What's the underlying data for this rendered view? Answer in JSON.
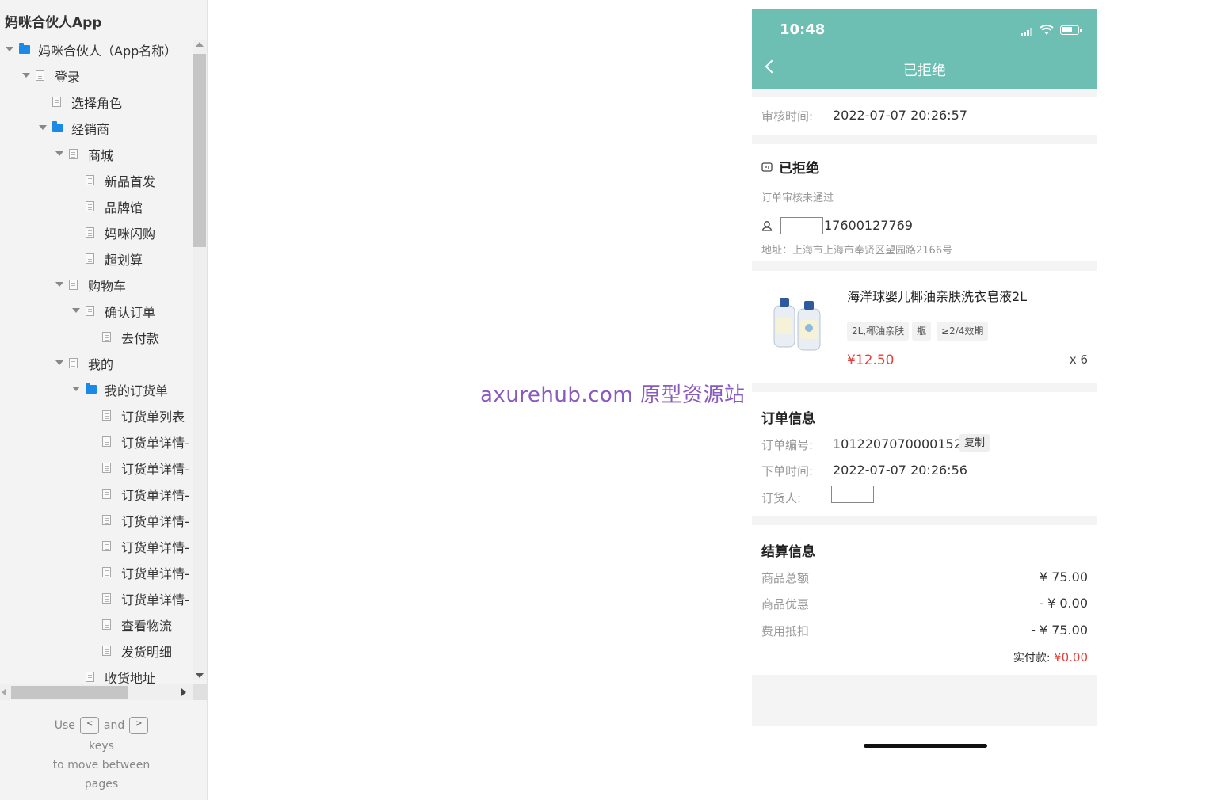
{
  "sitemap": {
    "app_title": "妈咪合伙人App",
    "items": [
      {
        "label": "妈咪合伙人（App名称）",
        "level": 0,
        "icon": "folder-icon",
        "expanded": true
      },
      {
        "label": "登录",
        "level": 1,
        "icon": "page-icon",
        "expanded": true
      },
      {
        "label": "选择角色",
        "level": 2,
        "icon": "page-icon",
        "expanded": null
      },
      {
        "label": "经销商",
        "level": 2,
        "icon": "folder-icon",
        "expanded": true
      },
      {
        "label": "商城",
        "level": 3,
        "icon": "page-icon",
        "expanded": true
      },
      {
        "label": "新品首发",
        "level": 4,
        "icon": "page-icon",
        "expanded": null
      },
      {
        "label": "品牌馆",
        "level": 4,
        "icon": "page-icon",
        "expanded": null
      },
      {
        "label": "妈咪闪购",
        "level": 4,
        "icon": "page-icon",
        "expanded": null
      },
      {
        "label": "超划算",
        "level": 4,
        "icon": "page-icon",
        "expanded": null
      },
      {
        "label": "购物车",
        "level": 3,
        "icon": "page-icon",
        "expanded": true
      },
      {
        "label": "确认订单",
        "level": 4,
        "icon": "page-icon",
        "expanded": true
      },
      {
        "label": "去付款",
        "level": 5,
        "icon": "page-icon",
        "expanded": null
      },
      {
        "label": "我的",
        "level": 3,
        "icon": "page-icon",
        "expanded": true
      },
      {
        "label": "我的订货单",
        "level": 4,
        "icon": "folder-icon",
        "expanded": true
      },
      {
        "label": "订货单列表",
        "level": 5,
        "icon": "page-icon",
        "expanded": null
      },
      {
        "label": "订货单详情-",
        "level": 5,
        "icon": "page-icon",
        "expanded": null
      },
      {
        "label": "订货单详情-",
        "level": 5,
        "icon": "page-icon",
        "expanded": null
      },
      {
        "label": "订货单详情-",
        "level": 5,
        "icon": "page-icon",
        "expanded": null
      },
      {
        "label": "订货单详情-",
        "level": 5,
        "icon": "page-icon",
        "expanded": null
      },
      {
        "label": "订货单详情-",
        "level": 5,
        "icon": "page-icon",
        "expanded": null
      },
      {
        "label": "订货单详情-",
        "level": 5,
        "icon": "page-icon",
        "expanded": null
      },
      {
        "label": "订货单详情-",
        "level": 5,
        "icon": "page-icon",
        "expanded": null
      },
      {
        "label": "查看物流",
        "level": 5,
        "icon": "page-icon",
        "expanded": null
      },
      {
        "label": "发货明细",
        "level": 5,
        "icon": "page-icon",
        "expanded": null
      },
      {
        "label": "收货地址",
        "level": 4,
        "icon": "page-icon",
        "expanded": null
      }
    ],
    "help": {
      "use": "Use",
      "key_prev": "<",
      "and": "and",
      "key_next": ">",
      "keys": "keys",
      "line3": "to move between",
      "line4": "pages"
    }
  },
  "watermark": "axurehub.com 原型资源站",
  "phone": {
    "status_time": "10:48",
    "nav_title": "已拒绝",
    "audit": {
      "label": "审核时间:",
      "value": "2022-07-07 20:26:57"
    },
    "status": {
      "title": "已拒绝",
      "subtitle": "订单审核未通过",
      "phone_number": "17600127769",
      "address": "地址：上海市上海市奉贤区望园路2166号"
    },
    "product": {
      "name": "海洋球婴儿椰油亲肤洗衣皂液2L",
      "tags": [
        "2L,椰油亲肤",
        "瓶",
        "≥2/4效期"
      ],
      "price": "¥12.50",
      "quantity": "x 6"
    },
    "order_info": {
      "title": "订单信息",
      "order_no_label": "订单编号:",
      "order_no": "10122070700001528",
      "copy_label": "复制",
      "time_label": "下单时间:",
      "time": "2022-07-07 20:26:56",
      "orderer_label": "订货人:"
    },
    "settlement": {
      "title": "结算信息",
      "rows": [
        {
          "label": "商品总额",
          "value": "¥ 75.00"
        },
        {
          "label": "商品优惠",
          "value": "- ¥ 0.00"
        },
        {
          "label": "费用抵扣",
          "value": "- ¥ 75.00"
        }
      ],
      "paid_label": "实付款:",
      "paid_value": "¥0.00"
    }
  },
  "colors": {
    "header": "#6dbfb4",
    "price": "#e0423a",
    "folder": "#1a8ae6"
  }
}
